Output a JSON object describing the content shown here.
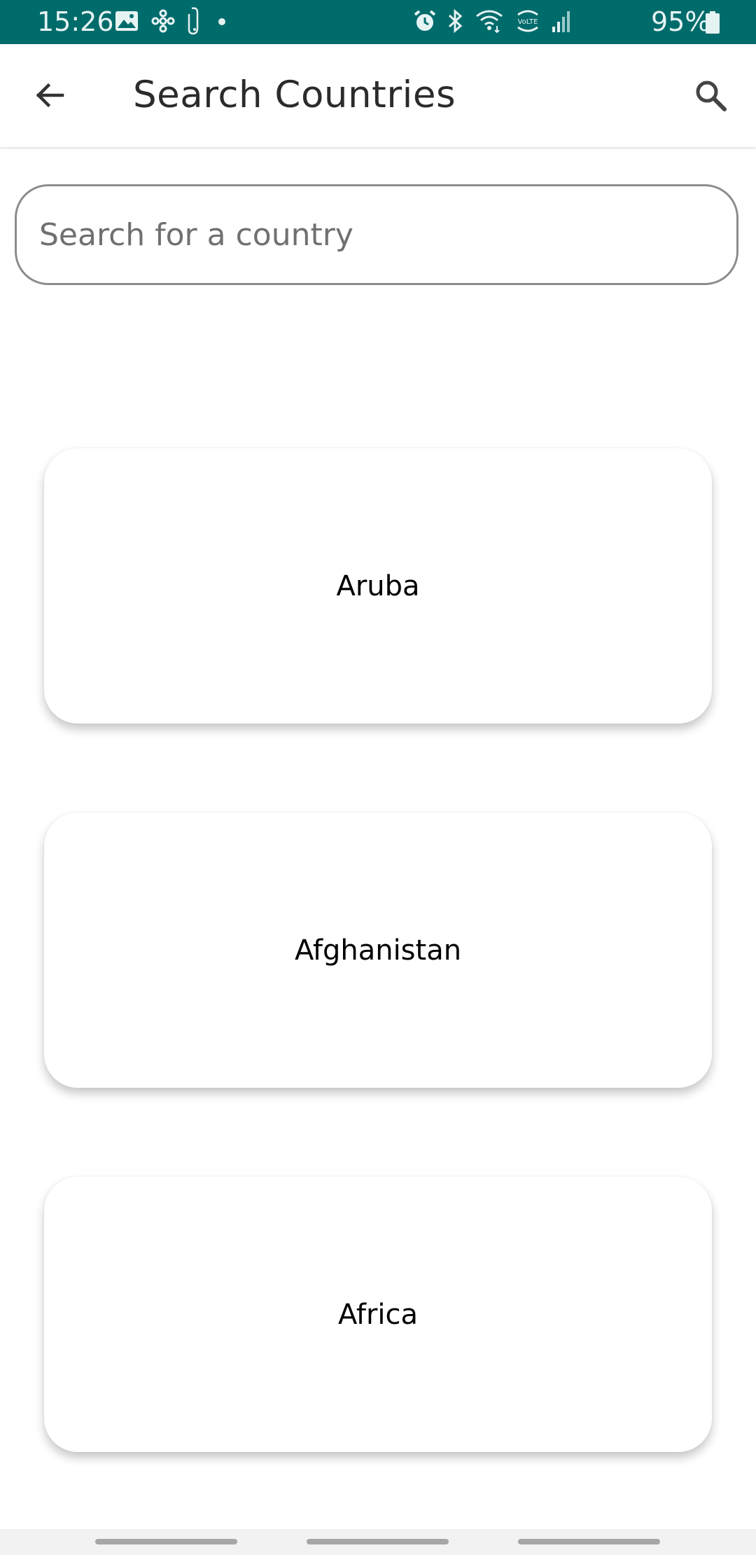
{
  "status_bar": {
    "time": "15:26",
    "battery_percent": "95%",
    "background_color": "#006b6b",
    "left_icons": [
      "gallery-icon",
      "fan-icon",
      "tag-icon",
      "dot-icon"
    ],
    "right_icons": [
      "alarm-icon",
      "bluetooth-icon",
      "wifi-icon",
      "volte-icon",
      "signal-icon"
    ]
  },
  "app_bar": {
    "title": "Search Countries",
    "back_icon": "arrow-left-icon",
    "search_icon": "search-icon"
  },
  "search": {
    "value": "",
    "placeholder": "Search for a country"
  },
  "countries": [
    {
      "label": "Aruba"
    },
    {
      "label": "Afghanistan"
    },
    {
      "label": "Africa"
    }
  ]
}
